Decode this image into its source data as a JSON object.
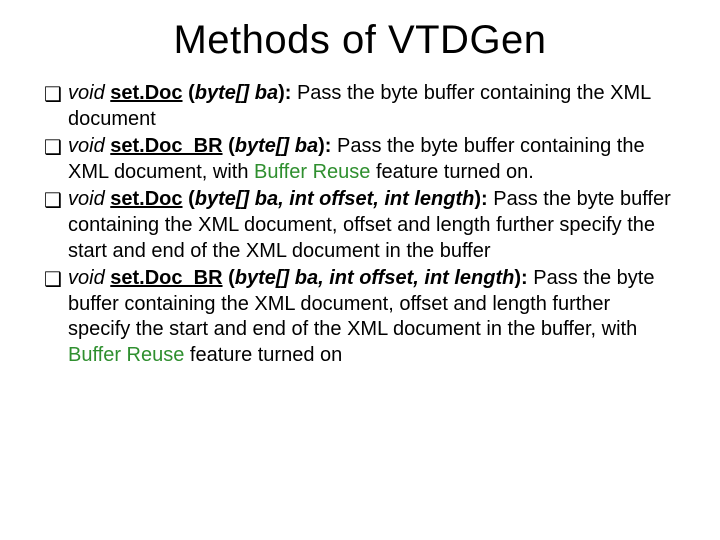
{
  "title": "Methods of VTDGen",
  "bullet_glyph": "❑",
  "items": [
    {
      "sig_ret": "void",
      "sig_name": "set.Doc",
      "sig_params": "byte[] ba",
      "desc_pre": " Pass the byte buffer containing the XML document",
      "highlight": "",
      "desc_post": ""
    },
    {
      "sig_ret": "void",
      "sig_name": "set.Doc_BR",
      "sig_params": "byte[] ba",
      "desc_pre": " Pass the byte buffer containing the XML document, with ",
      "highlight": "Buffer Reuse",
      "desc_post": " feature turned on."
    },
    {
      "sig_ret": "void",
      "sig_name": "set.Doc",
      "sig_params": "byte[] ba, int offset, int length",
      "desc_pre": " Pass the byte buffer containing the XML document, offset and length further specify the start and end of the XML document in the buffer",
      "highlight": "",
      "desc_post": ""
    },
    {
      "sig_ret": "void",
      "sig_name": "set.Doc_BR",
      "sig_params": "byte[] ba, int offset, int length",
      "desc_pre": " Pass the byte buffer containing the XML document, offset and length further specify the start and end of the XML document in the buffer, with ",
      "highlight": "Buffer Reuse",
      "desc_post": " feature turned on"
    }
  ]
}
